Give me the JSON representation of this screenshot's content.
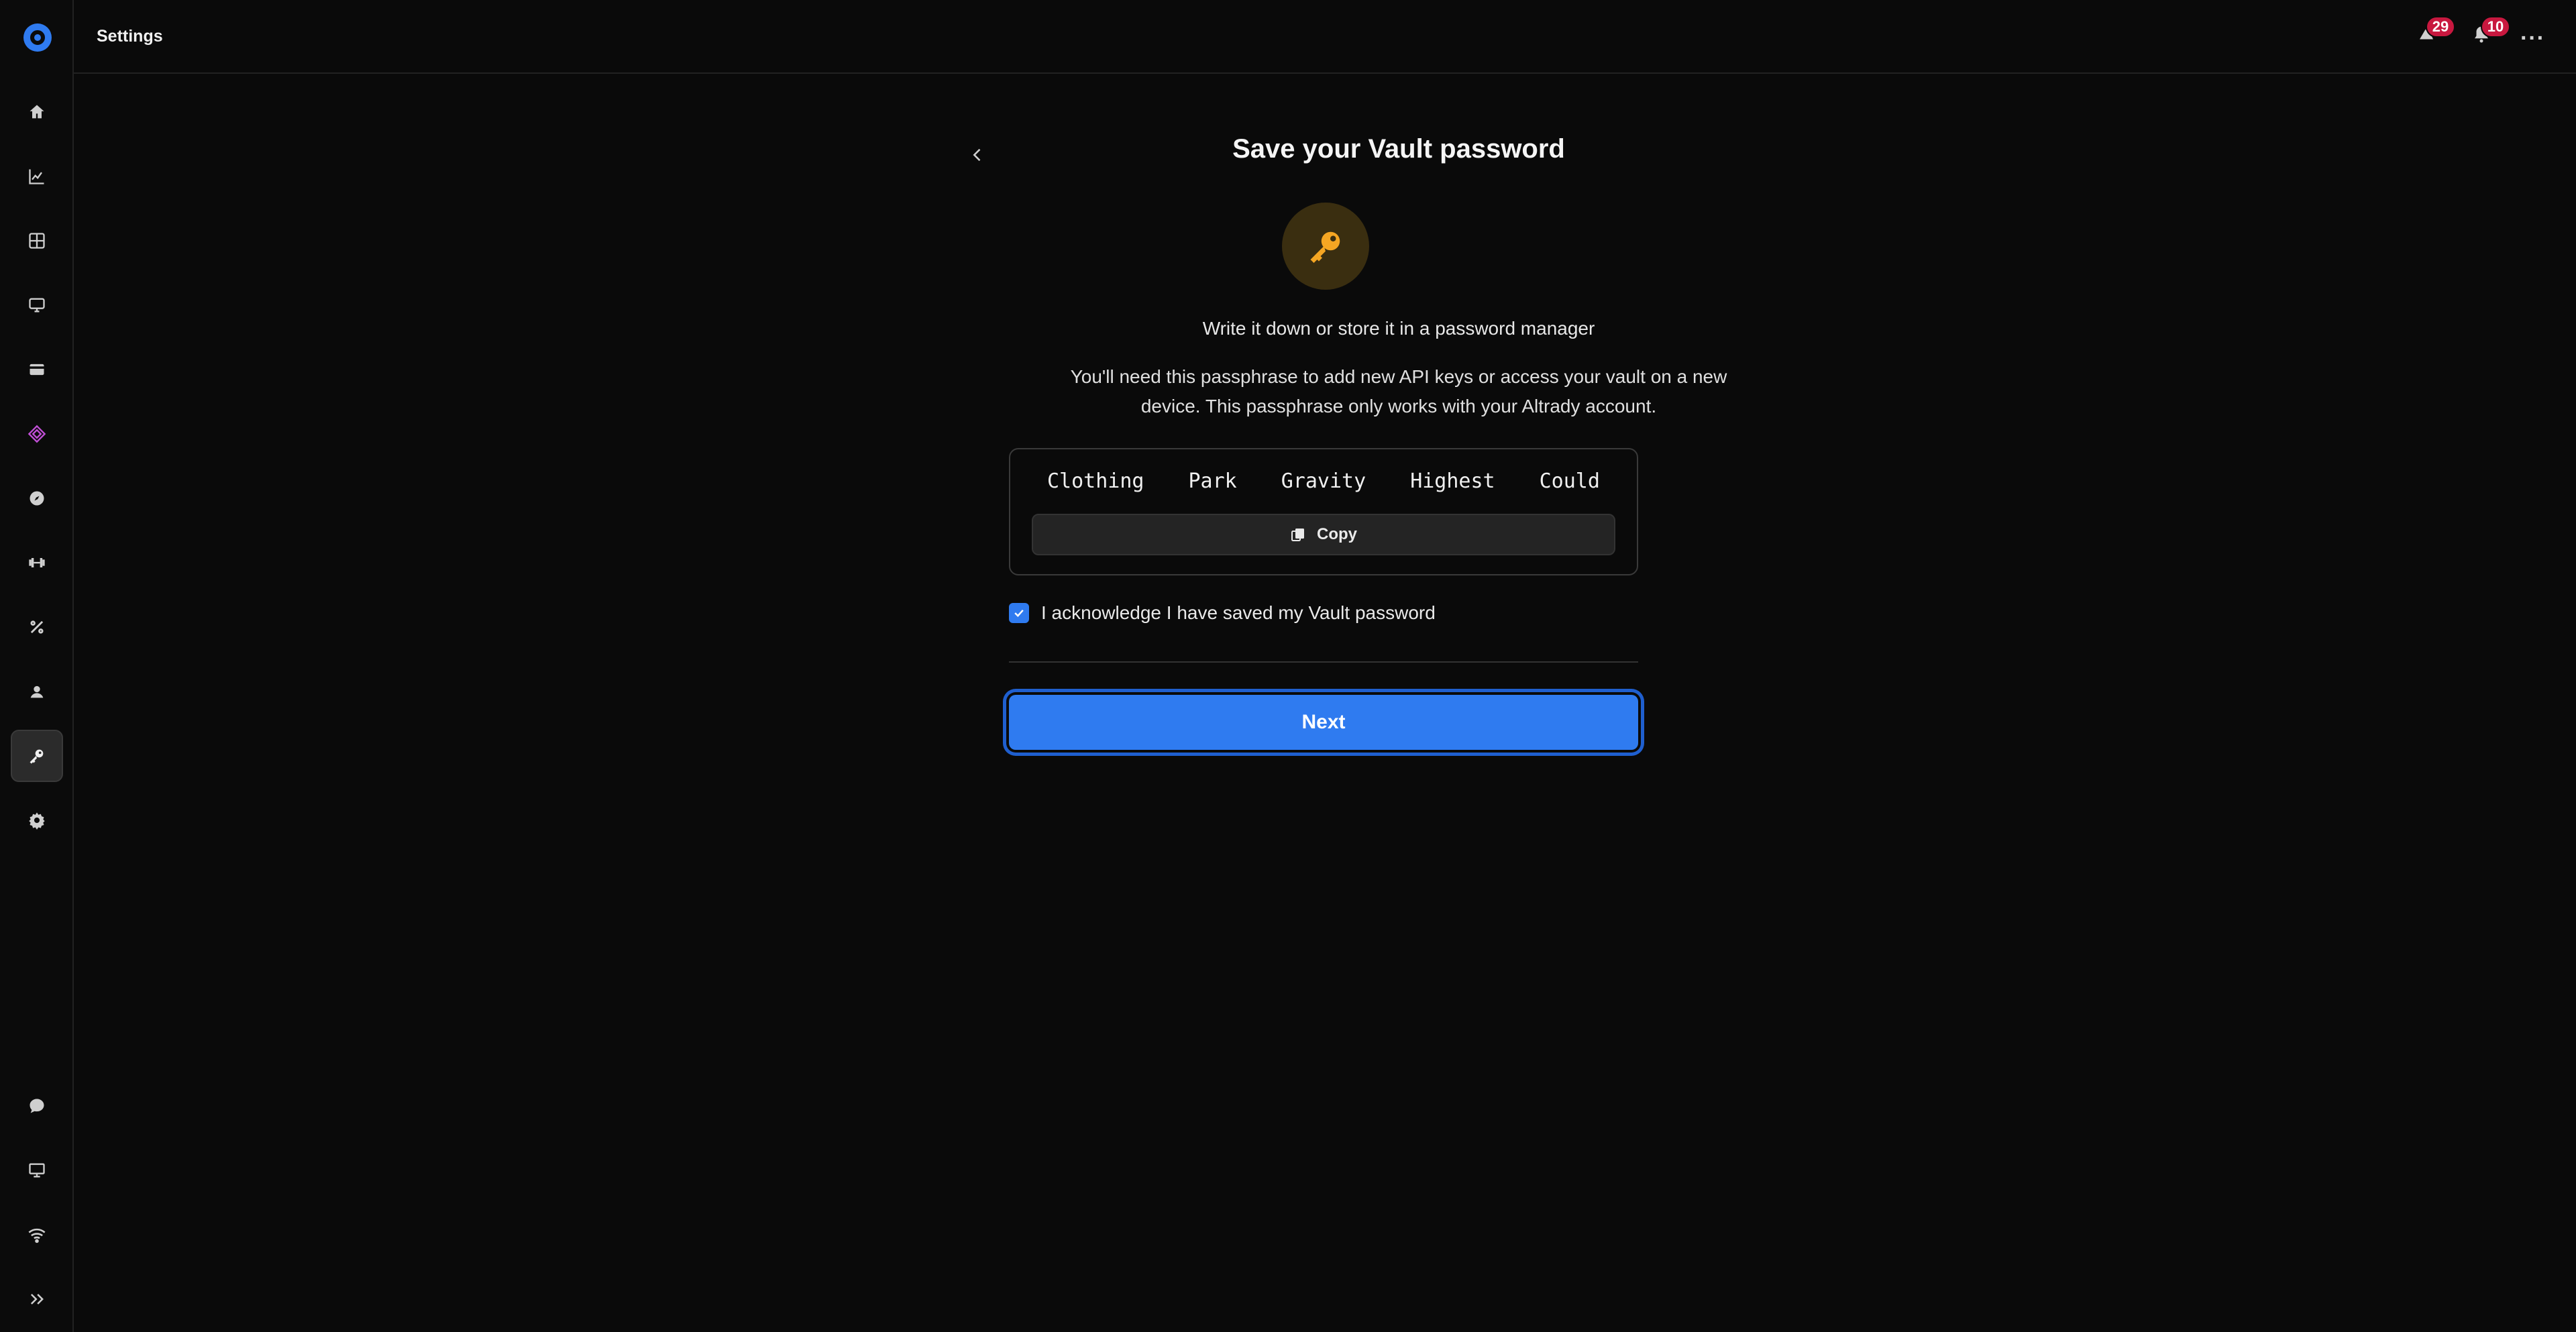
{
  "topbar": {
    "title": "Settings",
    "badges": {
      "alerts_count": "29",
      "notifications_count": "10"
    }
  },
  "sidebar": {
    "items": [
      {
        "icon": "home-icon"
      },
      {
        "icon": "chart-icon"
      },
      {
        "icon": "grid-icon"
      },
      {
        "icon": "terminal-icon"
      },
      {
        "icon": "wallet-icon"
      },
      {
        "icon": "layers-icon",
        "color": "#c14fd6"
      },
      {
        "icon": "compass-icon"
      },
      {
        "icon": "dumbbell-icon"
      },
      {
        "icon": "percent-icon"
      },
      {
        "icon": "user-badge-icon"
      },
      {
        "icon": "key-icon",
        "active": true
      },
      {
        "icon": "gear-icon"
      }
    ],
    "bottom_items": [
      {
        "icon": "chat-icon"
      },
      {
        "icon": "monitor-icon"
      },
      {
        "icon": "wifi-icon"
      },
      {
        "icon": "expand-icon"
      }
    ]
  },
  "main": {
    "title": "Save your Vault password",
    "subtitle": "Write it down or store it in a password manager",
    "description": "You'll need this passphrase to add new API keys or access your vault on a new device. This passphrase only works with your Altrady account.",
    "passphrase": [
      "Clothing",
      "Park",
      "Gravity",
      "Highest",
      "Could"
    ],
    "copy_label": "Copy",
    "ack_label": "I acknowledge I have saved my Vault password",
    "ack_checked": true,
    "next_label": "Next"
  },
  "colors": {
    "accent": "#2f7bf0",
    "key": "#f5a623",
    "badge": "#c8183f"
  }
}
